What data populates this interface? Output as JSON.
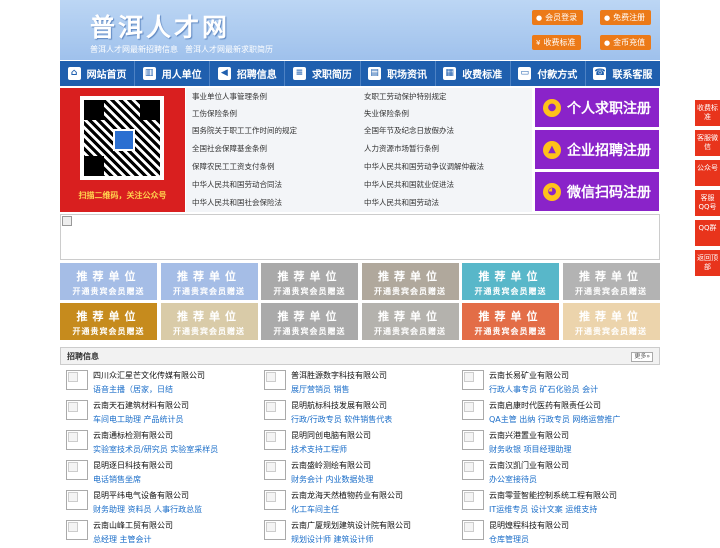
{
  "header": {
    "title": "普洱人才网",
    "sub": [
      "普洱人才网最新招聘信息",
      "普洱人才网最新求职简历"
    ],
    "buttons": [
      {
        "label": "会员登录",
        "icon": "user-icon"
      },
      {
        "label": "免费注册",
        "icon": "register-icon"
      },
      {
        "label": "收费标准",
        "icon": "yen-icon"
      },
      {
        "label": "金币充值",
        "icon": "coin-icon"
      }
    ]
  },
  "nav": [
    {
      "label": "网站首页",
      "icon": "home-icon"
    },
    {
      "label": "用人单位",
      "icon": "building-icon"
    },
    {
      "label": "招聘信息",
      "icon": "megaphone-icon"
    },
    {
      "label": "求职简历",
      "icon": "resume-icon"
    },
    {
      "label": "职场资讯",
      "icon": "news-icon"
    },
    {
      "label": "收费标准",
      "icon": "fee-icon"
    },
    {
      "label": "付款方式",
      "icon": "payment-icon"
    },
    {
      "label": "联系客服",
      "icon": "phone-icon"
    }
  ],
  "qr": {
    "caption": "扫描二维码，关注公众号"
  },
  "policies": [
    [
      "事业单位人事管理条例",
      "女职工劳动保护特别规定"
    ],
    [
      "工伤保险条例",
      "失业保险条例"
    ],
    [
      "国务院关于职工工作时间的规定",
      "全国年节及纪念日放假办法"
    ],
    [
      "全国社会保障基金条例",
      "人力资源市场暂行条例"
    ],
    [
      "保障农民工工资支付条例",
      "中华人民共和国劳动争议调解仲裁法"
    ],
    [
      "中华人民共和国劳动合同法",
      "中华人民共和国就业促进法"
    ],
    [
      "中华人民共和国社会保险法",
      "中华人民共和国劳动法"
    ]
  ],
  "register": [
    {
      "label": "个人求职注册",
      "icon": "person-icon"
    },
    {
      "label": "企业招聘注册",
      "icon": "company-icon"
    },
    {
      "label": "微信扫码注册",
      "icon": "wechat-icon"
    }
  ],
  "ads": {
    "line1": "推荐单位",
    "line2": "开通贵宾会员赠送",
    "colors": [
      "#a5bde6",
      "#a5bde6",
      "#a9a9a9",
      "#b0a89c",
      "#58b7c9",
      "#b3b3b3",
      "#c68b1d",
      "#d9cba8",
      "#aaaaaa",
      "#b4b2ad",
      "#e36d47",
      "#ecd4ac"
    ]
  },
  "jobs": {
    "title": "招聘信息",
    "more": "更多»",
    "items": [
      {
        "company": "四川众汇星芒文化传媒有限公司",
        "positions": "语音主播（居家，日结"
      },
      {
        "company": "普洱胜源数字科技有限公司",
        "positions": "展厅营销员 销售"
      },
      {
        "company": "云南长易矿业有限公司",
        "positions": "行政人事专员 矿石化验员 会计"
      },
      {
        "company": "云南天石建筑材料有限公司",
        "positions": "车间电工助理 产品统计员"
      },
      {
        "company": "昆明航标科技发展有限公司",
        "positions": "行政/行政专员 软件销售代表"
      },
      {
        "company": "云南启康时代医药有限责任公司",
        "positions": "QA主管 出纳 行政专员 网络运营推广"
      },
      {
        "company": "云南通标检测有限公司",
        "positions": "实验室技术员/研究员 实验室采样员"
      },
      {
        "company": "昆明同创电脑有限公司",
        "positions": "技术支持工程师"
      },
      {
        "company": "云南兴港置业有限公司",
        "positions": "财务收银 项目经理助理"
      },
      {
        "company": "昆明逐日科技有限公司",
        "positions": "电话销售坐席"
      },
      {
        "company": "云南盛岭测绘有限公司",
        "positions": "财务会计 内业数据处理"
      },
      {
        "company": "云南汉凯门业有限公司",
        "positions": "办公室接待员"
      },
      {
        "company": "昆明平纬电气设备有限公司",
        "positions": "财务助理 资料员 人事行政总监"
      },
      {
        "company": "云南龙海天然植物药业有限公司",
        "positions": "化工车间主任"
      },
      {
        "company": "云南零萱智能控制系统工程有限公司",
        "positions": "IT运维专员 设计文案 运维支持"
      },
      {
        "company": "云南山峰工贸有限公司",
        "positions": "总经理 主管会计"
      },
      {
        "company": "云南广厦规划建筑设计院有限公司",
        "positions": "规划设计师 建筑设计师"
      },
      {
        "company": "昆明煌程科技有限公司",
        "positions": "仓库管理员"
      }
    ]
  },
  "sidebar": [
    "收费标准",
    "客服微信",
    "公众号",
    "客服QQ号",
    "QQ群",
    "返回顶部"
  ]
}
